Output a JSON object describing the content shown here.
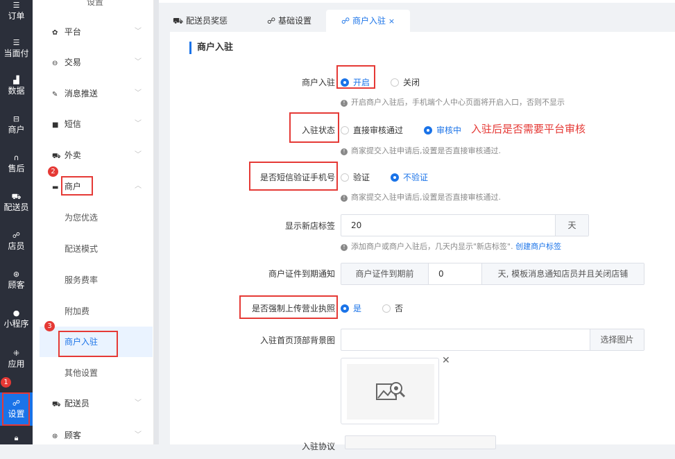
{
  "left_nav": [
    {
      "label": "订单",
      "icon": "list-icon"
    },
    {
      "label": "当面付",
      "icon": "list-icon"
    },
    {
      "label": "数据",
      "icon": "bar-chart-icon"
    },
    {
      "label": "商户",
      "icon": "store-icon"
    },
    {
      "label": "售后",
      "icon": "headset-icon"
    },
    {
      "label": "配送员",
      "icon": "delivery-icon"
    },
    {
      "label": "店员",
      "icon": "staff-icon"
    },
    {
      "label": "顾客",
      "icon": "customer-icon"
    },
    {
      "label": "小程序",
      "icon": "wechat-icon"
    },
    {
      "label": "应用",
      "icon": "apps-icon"
    },
    {
      "label": "设置",
      "icon": "settings-icon"
    },
    {
      "label": "",
      "icon": "lock-icon"
    }
  ],
  "menu": {
    "header": "设置",
    "items": [
      {
        "label": "平台",
        "icon": "gear-icon"
      },
      {
        "label": "交易",
        "icon": "transaction-icon"
      },
      {
        "label": "消息推送",
        "icon": "push-icon"
      },
      {
        "label": "短信",
        "icon": "sms-icon"
      },
      {
        "label": "外卖",
        "icon": "delivery-icon"
      },
      {
        "label": "商户",
        "icon": "store-icon"
      }
    ],
    "sub_items": [
      "为您优选",
      "配送模式",
      "服务费率",
      "附加费",
      "商户入驻",
      "其他设置"
    ],
    "bottom_items": [
      {
        "label": "配送员",
        "icon": "delivery-icon"
      },
      {
        "label": "顾客",
        "icon": "customer-icon"
      }
    ]
  },
  "tabs": [
    {
      "label": "配送员奖惩"
    },
    {
      "label": "基础设置"
    },
    {
      "label": "商户入驻",
      "close": "×"
    }
  ],
  "section_title": "商户入驻",
  "form": {
    "merchant_entry": {
      "label": "商户入驻",
      "options": [
        "开启",
        "关闭"
      ],
      "tip": "开启商户入驻后，手机端个人中心页面将开启入口，否则不显示"
    },
    "entry_status": {
      "label": "入驻状态",
      "options": [
        "直接审核通过",
        "审核中"
      ],
      "tip": "商家提交入驻申请后,设置是否直接审核通过."
    },
    "sms_verify": {
      "label": "是否短信验证手机号",
      "options": [
        "验证",
        "不验证"
      ],
      "tip": "商家提交入驻申请后,设置是否直接审核通过."
    },
    "new_store_tag": {
      "label": "显示新店标签",
      "value": "20",
      "suffix": "天",
      "tip": "添加商户或商户入驻后，几天内显示\"新店标签\".",
      "link": "创建商户标签"
    },
    "license_expiry": {
      "label": "商户证件到期通知",
      "prefix": "商户证件到期前",
      "value": "0",
      "suffix": "天, 模板消息通知店员并且关闭店铺"
    },
    "force_license": {
      "label": "是否强制上传营业执照",
      "options": [
        "是",
        "否"
      ]
    },
    "entry_bg": {
      "label": "入驻首页顶部背景图",
      "button": "选择图片"
    },
    "next_label": "入驻协议"
  },
  "annotation": "入驻后是否需要平台审核",
  "badges": [
    "1",
    "2",
    "3"
  ],
  "colors": {
    "primary": "#1a73e8",
    "annotation_red": "#e53935",
    "sidebar_dark": "#2b2f3a"
  }
}
